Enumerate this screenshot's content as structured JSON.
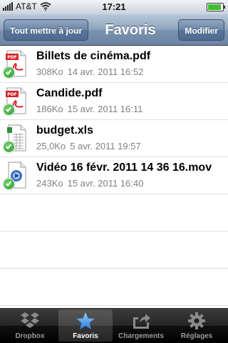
{
  "status_bar": {
    "carrier": "AT&T",
    "time": "17:21"
  },
  "nav": {
    "back_label": "Tout mettre à jour",
    "title": "Favoris",
    "edit_label": "Modifier"
  },
  "files": [
    {
      "name": "Billets de cinéma.pdf",
      "size": "308Ko",
      "date": "14 avr. 2011 16:52",
      "icon": "pdf-icon"
    },
    {
      "name": "Candide.pdf",
      "size": "186Ko",
      "date": "15 avr. 2011 16:11",
      "icon": "pdf-icon"
    },
    {
      "name": "budget.xls",
      "size": "25,0Ko",
      "date": "5 avr. 2011 19:57",
      "icon": "spreadsheet-icon"
    },
    {
      "name": "Vidéo 16 févr. 2011 14 36 16.mov",
      "size": "243Ko",
      "date": "15 avr. 2011 16:40",
      "icon": "video-file-icon"
    }
  ],
  "tabs": [
    {
      "label": "Dropbox",
      "icon": "dropbox-icon",
      "active": false
    },
    {
      "label": "Favoris",
      "icon": "star-icon",
      "active": true
    },
    {
      "label": "Chargements",
      "icon": "upload-icon",
      "active": false
    },
    {
      "label": "Réglages",
      "icon": "gear-icon",
      "active": false
    }
  ],
  "colors": {
    "nav_bar": "#7b92af",
    "tab_active": "#4ea1f0",
    "synced_check": "#2f9b2f",
    "pdf_red": "#d8232a"
  }
}
